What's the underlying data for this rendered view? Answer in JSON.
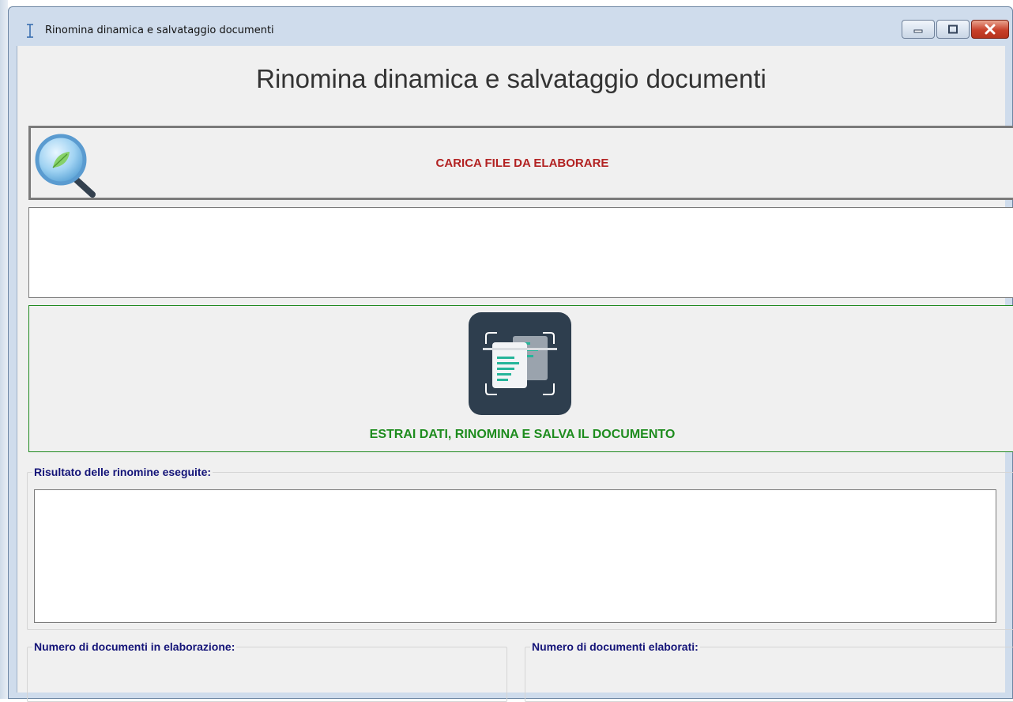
{
  "window": {
    "title": "Rinomina dinamica e salvataggio documenti",
    "controls": [
      "minimize",
      "maximize",
      "close"
    ]
  },
  "app": {
    "heading": "Rinomina dinamica e salvataggio documenti"
  },
  "load_button": {
    "label": "CARICA FILE DA ELABORARE",
    "icon": "magnifier-icon",
    "color": "#b22222"
  },
  "selected_files": {
    "value": ""
  },
  "extract_button": {
    "label": "ESTRAI DATI, RINOMINA E SALVA IL DOCUMENTO",
    "icon": "document-scan-icon",
    "color": "#1e8c1e"
  },
  "results": {
    "label": "Risultato delle rinomine eseguite:",
    "value": ""
  },
  "counters": {
    "in_progress_label": "Numero di documenti in elaborazione:",
    "done_label": "Numero di documenti elaborati:"
  },
  "colors": {
    "group_label": "#141478",
    "accent_red": "#b22222",
    "accent_green": "#1e8c1e"
  }
}
